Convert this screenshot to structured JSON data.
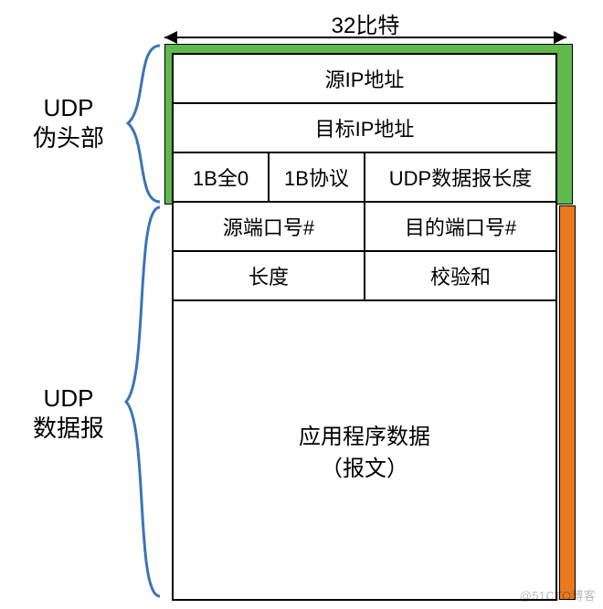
{
  "width_label": "32比特",
  "pseudo_label_l1": "UDP",
  "pseudo_label_l2": "伪头部",
  "dgram_label_l1": "UDP",
  "dgram_label_l2": "数据报",
  "rows": {
    "src_ip": "源IP地址",
    "dst_ip": "目标IP地址",
    "zero8": "1B全0",
    "proto8": "1B协议",
    "udp_len": "UDP数据报长度",
    "src_port": "源端口号#",
    "dst_port": "目的端口号#",
    "length": "长度",
    "checksum": "校验和",
    "app_l1": "应用程序数据",
    "app_l2": "（报文）"
  },
  "watermark": "@51CTO博客",
  "chart_data": {
    "type": "table",
    "title": "UDP伪头部与数据报结构",
    "total_width_bits": 32,
    "sections": [
      {
        "name": "UDP伪头部",
        "rows": [
          [
            {
              "field": "源IP地址",
              "bits": 32
            }
          ],
          [
            {
              "field": "目标IP地址",
              "bits": 32
            }
          ],
          [
            {
              "field": "1B全0",
              "bits": 8
            },
            {
              "field": "1B协议",
              "bits": 8
            },
            {
              "field": "UDP数据报长度",
              "bits": 16
            }
          ]
        ]
      },
      {
        "name": "UDP数据报",
        "rows": [
          [
            {
              "field": "源端口号#",
              "bits": 16
            },
            {
              "field": "目的端口号#",
              "bits": 16
            }
          ],
          [
            {
              "field": "长度",
              "bits": 16
            },
            {
              "field": "校验和",
              "bits": 16
            }
          ],
          [
            {
              "field": "应用程序数据（报文）",
              "bits": "variable"
            }
          ]
        ]
      }
    ]
  }
}
